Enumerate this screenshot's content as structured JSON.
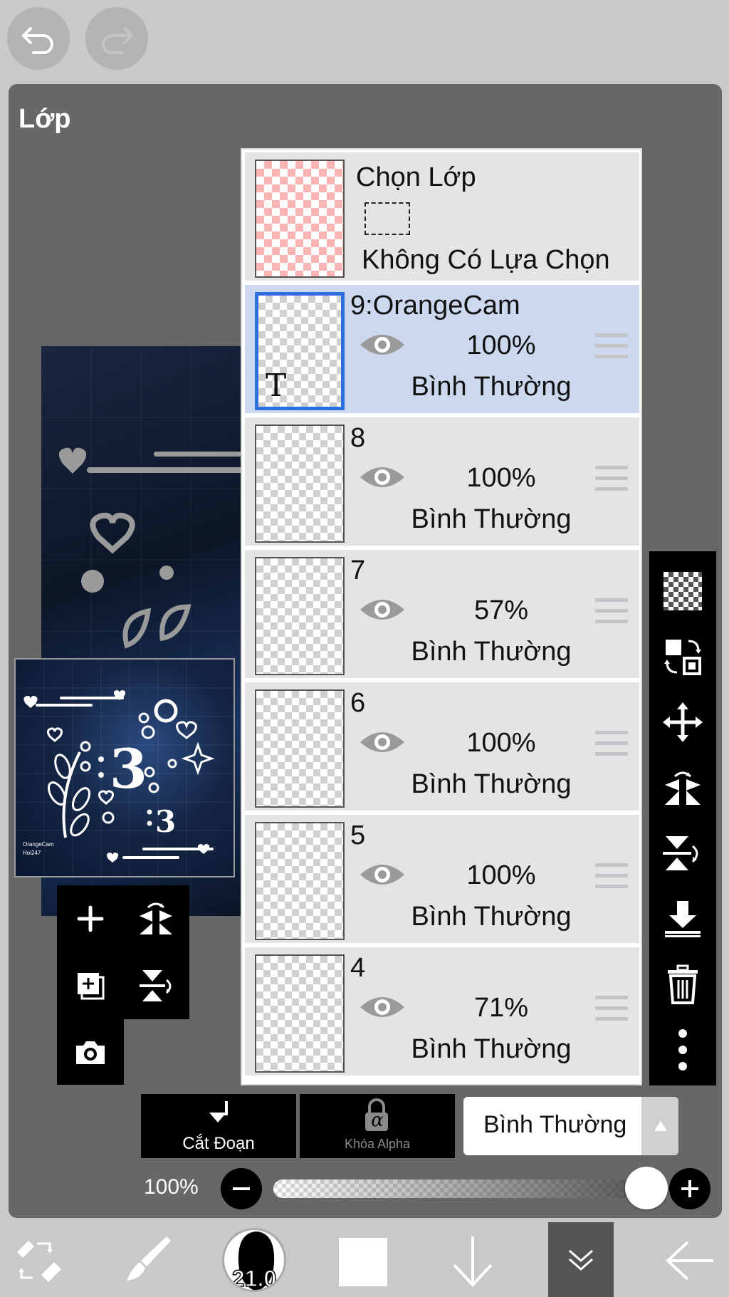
{
  "title": "Lớp",
  "selection_layer": {
    "name": "Chọn Lớp",
    "status": "Không Có Lựa Chọn"
  },
  "layers": [
    {
      "name": "9:OrangeCam",
      "opacity": "100%",
      "blend": "Bình Thường",
      "type_glyph": "T"
    },
    {
      "name": "8",
      "opacity": "100%",
      "blend": "Bình Thường"
    },
    {
      "name": "7",
      "opacity": "57%",
      "blend": "Bình Thường"
    },
    {
      "name": "6",
      "opacity": "100%",
      "blend": "Bình Thường"
    },
    {
      "name": "5",
      "opacity": "100%",
      "blend": "Bình Thường"
    },
    {
      "name": "4",
      "opacity": "71%",
      "blend": "Bình Thường"
    }
  ],
  "bottom_controls": {
    "clip_label": "Cắt Đoạn",
    "alpha_label": "Khóa Alpha",
    "alpha_glyph": "α",
    "blend_mode": "Bình Thường",
    "opacity_label": "100%",
    "opacity_value": 1.0
  },
  "toolbar": {
    "brush_size": "21.0"
  },
  "thumbnail_text": {
    "line1": "OrangeCam",
    "line2": "Hoi247",
    "big_glyph": "3",
    "small_glyph": "3"
  },
  "icons": {
    "top": [
      "undo-icon",
      "redo-icon"
    ],
    "left_tools": [
      "add-layer-icon",
      "flip-horizontal-icon",
      "add-layer-copy-icon",
      "flip-vertical-icon",
      "camera-icon"
    ],
    "right_tools": [
      "transparent-icon",
      "select-layer-icon",
      "move-icon",
      "flip-h-icon",
      "flip-v-icon",
      "merge-down-icon",
      "delete-icon",
      "more-icon"
    ],
    "bottom": [
      "swap-icon",
      "brush-icon",
      "brush-size-icon",
      "color-swatch-icon",
      "arrow-down-icon",
      "collapse-icon",
      "back-icon"
    ]
  },
  "colors": {
    "active_layer": "#cbd8ee",
    "active_border": "#2d6fdc",
    "selection_checker": "#fbb4b4"
  }
}
